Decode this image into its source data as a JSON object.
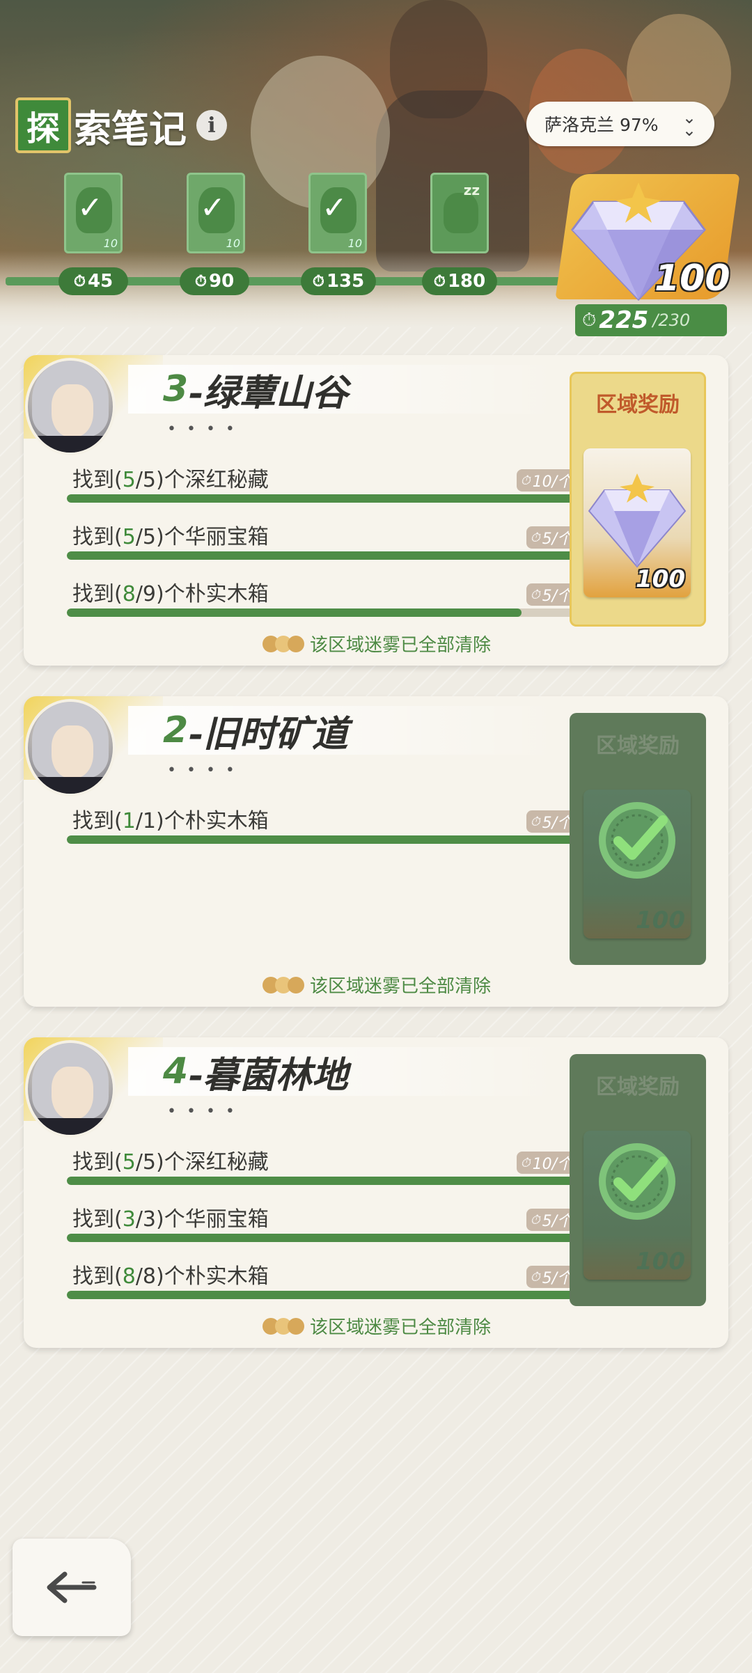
{
  "header": {
    "title_first": "探",
    "title_rest": "索笔记",
    "info_label": "i",
    "region_selector": "萨洛克兰 97%",
    "milestones": [
      {
        "value": "45",
        "card_num": "10",
        "state": "claimed"
      },
      {
        "value": "90",
        "card_num": "10",
        "state": "claimed"
      },
      {
        "value": "135",
        "card_num": "10",
        "state": "claimed"
      },
      {
        "value": "180",
        "card_num": "",
        "state": "locked"
      }
    ],
    "reward_value": "100",
    "score_current": "225",
    "score_max": "/230"
  },
  "areas": [
    {
      "number": "3",
      "name": "-绿蕈山谷",
      "dots": "• • • •",
      "reward_label": "区域奖励",
      "reward_value": "100",
      "reward_state": "available",
      "fog_text": "该区域迷雾已全部清除",
      "tasks": [
        {
          "prefix": "找到(",
          "found": "5",
          "total": "/5)",
          "suffix": "个深红秘藏",
          "points": "10/个",
          "progress": 1.0
        },
        {
          "prefix": "找到(",
          "found": "5",
          "total": "/5)",
          "suffix": "个华丽宝箱",
          "points": "5/个",
          "progress": 1.0
        },
        {
          "prefix": "找到(",
          "found": "8",
          "total": "/9)",
          "suffix": "个朴实木箱",
          "points": "5/个",
          "progress": 0.89
        }
      ]
    },
    {
      "number": "2",
      "name": "-旧时矿道",
      "dots": "• • • •",
      "reward_label": "区域奖励",
      "reward_value": "100",
      "reward_state": "claimed",
      "fog_text": "该区域迷雾已全部清除",
      "tasks": [
        {
          "prefix": "找到(",
          "found": "1",
          "total": "/1)",
          "suffix": "个朴实木箱",
          "points": "5/个",
          "progress": 1.0
        }
      ]
    },
    {
      "number": "4",
      "name": "-暮菌林地",
      "dots": "• • • •",
      "reward_label": "区域奖励",
      "reward_value": "100",
      "reward_state": "claimed",
      "fog_text": "该区域迷雾已全部清除",
      "tasks": [
        {
          "prefix": "找到(",
          "found": "5",
          "total": "/5)",
          "suffix": "个深红秘藏",
          "points": "10/个",
          "progress": 1.0
        },
        {
          "prefix": "找到(",
          "found": "3",
          "total": "/3)",
          "suffix": "个华丽宝箱",
          "points": "5/个",
          "progress": 1.0
        },
        {
          "prefix": "找到(",
          "found": "8",
          "total": "/8)",
          "suffix": "个朴实木箱",
          "points": "5/个",
          "progress": 1.0
        }
      ]
    }
  ],
  "icons": {
    "info": "info-icon",
    "chevron": "double-chevron-down-icon",
    "stopwatch": "stopwatch-icon",
    "crystal": "crystal-icon",
    "check": "check-icon",
    "back": "back-arrow-icon"
  },
  "colors": {
    "accent_green": "#4e8d47",
    "reward_gold": "#e8c75a",
    "reward_label": "#c05a2b"
  }
}
